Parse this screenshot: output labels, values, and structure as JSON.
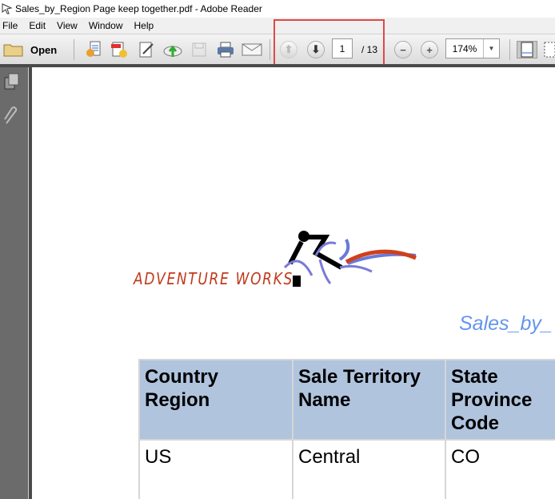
{
  "window": {
    "title": "Sales_by_Region Page keep together.pdf - Adobe Reader"
  },
  "menu": [
    "File",
    "Edit",
    "View",
    "Window",
    "Help"
  ],
  "toolbar": {
    "open_label": "Open",
    "page_current": "1",
    "page_total": "/ 13",
    "zoom": "174%"
  },
  "document": {
    "logo_text": "ADVENTURE WORKS",
    "report_title": "Sales_by_",
    "table": {
      "headers": [
        "Country Region",
        "Sale Territory Name",
        "State Province Code"
      ],
      "rows": [
        [
          "US",
          "Central",
          "CO"
        ]
      ]
    }
  },
  "colors": {
    "highlight": "#e04848",
    "header_bg": "#b0c4de",
    "title": "#6495ed",
    "logo": "#c0391b"
  }
}
